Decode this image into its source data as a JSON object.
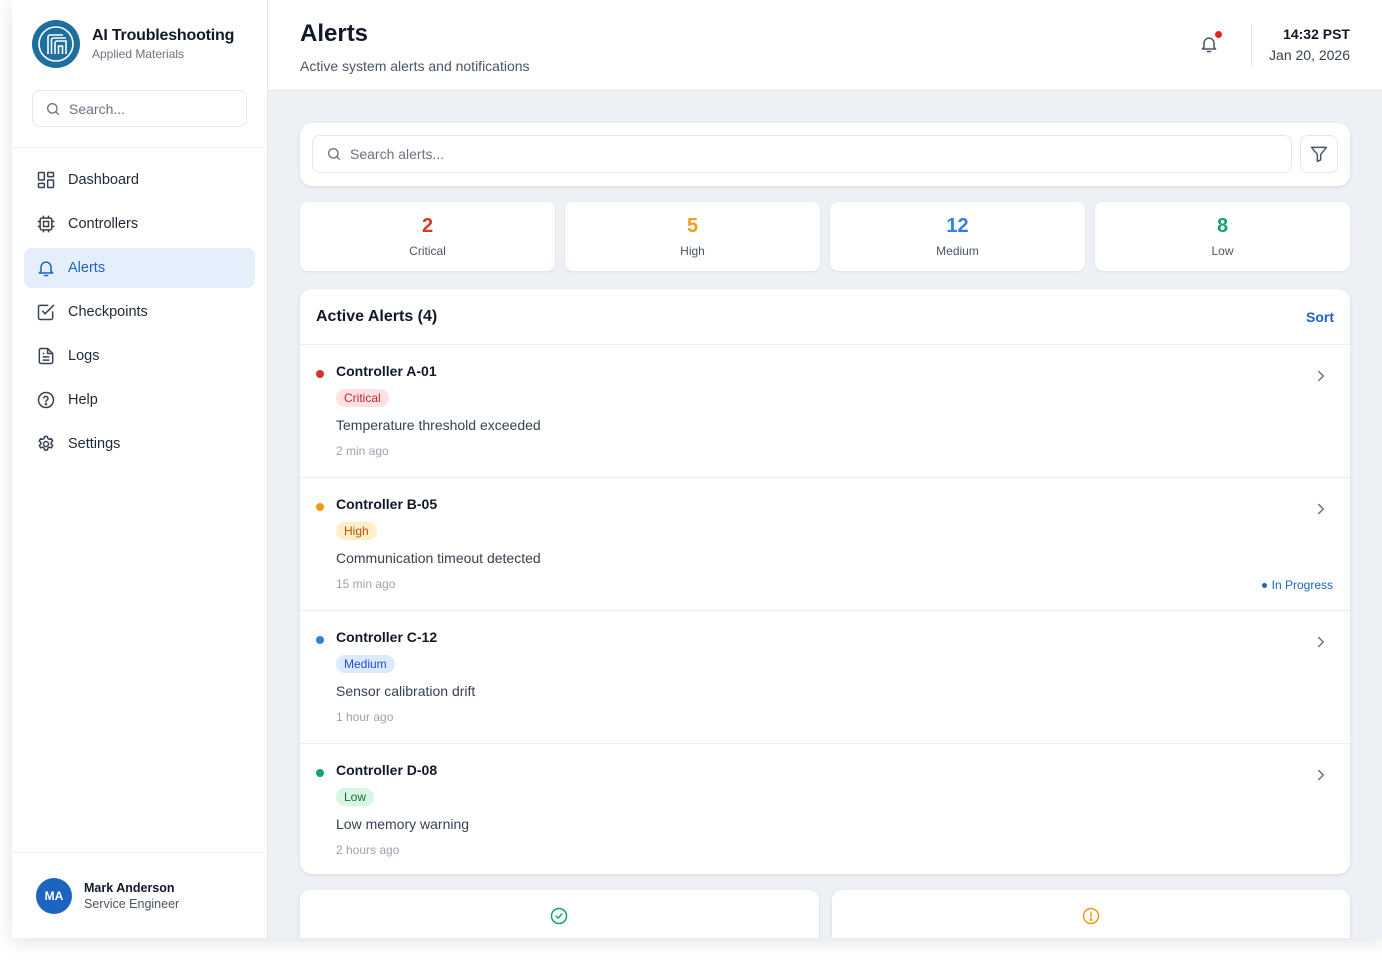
{
  "brand": {
    "title": "AI Troubleshooting",
    "subtitle": "Applied Materials"
  },
  "sidebar": {
    "search_placeholder": "Search...",
    "items": [
      {
        "label": "Dashboard",
        "icon": "dashboard-icon"
      },
      {
        "label": "Controllers",
        "icon": "chip-icon"
      },
      {
        "label": "Alerts",
        "icon": "bell-icon",
        "active": true
      },
      {
        "label": "Checkpoints",
        "icon": "checkbox-icon"
      },
      {
        "label": "Logs",
        "icon": "document-icon"
      },
      {
        "label": "Help",
        "icon": "help-icon"
      },
      {
        "label": "Settings",
        "icon": "gear-icon"
      }
    ]
  },
  "user": {
    "initials": "MA",
    "name": "Mark Anderson",
    "role": "Service Engineer"
  },
  "header": {
    "title": "Alerts",
    "subtitle": "Active system alerts and notifications",
    "time": "14:32 PST",
    "date": "Jan 20, 2026"
  },
  "search": {
    "placeholder": "Search alerts..."
  },
  "stats": [
    {
      "value": "2",
      "label": "Critical",
      "color": "#d93a1f"
    },
    {
      "value": "5",
      "label": "High",
      "color": "#f29b18"
    },
    {
      "value": "12",
      "label": "Medium",
      "color": "#2f80ed"
    },
    {
      "value": "8",
      "label": "Low",
      "color": "#13a36b"
    }
  ],
  "alerts_panel": {
    "title": "Active Alerts (4)",
    "sort_label": "Sort",
    "alerts": [
      {
        "name": "Controller A-01",
        "severity": "Critical",
        "message": "Temperature threshold exceeded",
        "time": "2 min ago",
        "dot_color": "#d0342c",
        "badge_bg": "#fde2e1",
        "badge_fg": "#c0262d",
        "status": ""
      },
      {
        "name": "Controller B-05",
        "severity": "High",
        "message": "Communication timeout detected",
        "time": "15 min ago",
        "dot_color": "#f29b18",
        "badge_bg": "#feefc7",
        "badge_fg": "#b4540a",
        "status": "In Progress"
      },
      {
        "name": "Controller C-12",
        "severity": "Medium",
        "message": "Sensor calibration drift",
        "time": "1 hour ago",
        "dot_color": "#2f80ed",
        "badge_bg": "#dbeafe",
        "badge_fg": "#1d4ed8",
        "status": ""
      },
      {
        "name": "Controller D-08",
        "severity": "Low",
        "message": "Low memory warning",
        "time": "2 hours ago",
        "dot_color": "#13a36b",
        "badge_bg": "#d9f5e3",
        "badge_fg": "#156c3c",
        "status": ""
      }
    ]
  },
  "bottom_cards": [
    {
      "icon": "check-circle-icon",
      "color": "#13a36b"
    },
    {
      "icon": "alert-circle-icon",
      "color": "#f29b18"
    }
  ]
}
